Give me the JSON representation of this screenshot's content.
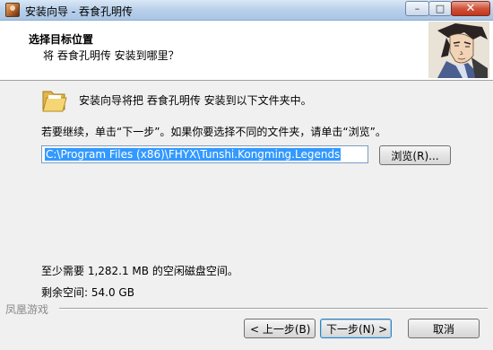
{
  "window": {
    "title": "安装向导 - 吞食孔明传",
    "min_label": "–",
    "max_label": "□",
    "close_label": "✕"
  },
  "header": {
    "title": "选择目标位置",
    "subtitle": "将 吞食孔明传 安装到哪里？"
  },
  "main": {
    "install_msg": "安装向导将把 吞食孔明传 安装到以下文件夹中。",
    "continue_msg": "若要继续，单击“下一步”。如果你要选择不同的文件夹，请单击“浏览”。",
    "install_path": "C:\\Program Files (x86)\\FHYX\\Tunshi.Kongming.Legends",
    "browse_label": "浏览(R)...",
    "space_required": "至少需要 1,282.1 MB 的空闲磁盘空间。",
    "space_free": "剩余空间: 54.0 GB"
  },
  "footer": {
    "brand": "凤凰游戏",
    "back_label": "< 上一步(B)",
    "next_label": "下一步(N) >",
    "cancel_label": "取消"
  },
  "icons": {
    "app": "app-icon",
    "folder": "folder-icon",
    "hero": "character-portrait"
  },
  "colors": {
    "selection": "#3399ff",
    "titlebar": "#b8d0ea",
    "close_button": "#c0361f"
  }
}
